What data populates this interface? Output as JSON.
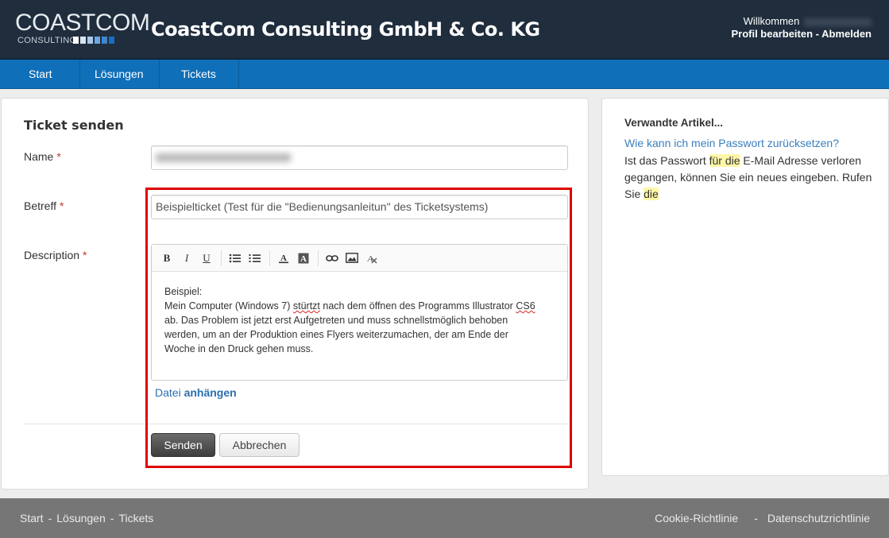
{
  "header": {
    "logo_text": "COASTCOM",
    "logo_subtext": "CONSULTING",
    "logo_square_colors": [
      "#ffffff",
      "#d6e4f3",
      "#a9c8ea",
      "#6ea6de",
      "#3f86cf",
      "#1e6bbd"
    ],
    "company_name": "CoastCom Consulting GmbH & Co. KG",
    "welcome_text": "Willkommen",
    "profile_link": "Profil bearbeiten",
    "separator": "-",
    "logout_link": "Abmelden"
  },
  "nav": {
    "items": [
      {
        "label": "Start"
      },
      {
        "label": "Lösungen"
      },
      {
        "label": "Tickets"
      }
    ]
  },
  "form": {
    "title": "Ticket senden",
    "required_marker": "*",
    "name_label": "Name",
    "subject_label": "Betreff",
    "subject_value": "Beispielticket (Test für die \"Bedienungsanleitun\" des Ticketsystems)",
    "description_label": "Description",
    "toolbar": {
      "bold": "B",
      "italic": "I",
      "underline": "U",
      "bullet_list_icon": "bullet-list-icon",
      "numbered_list_icon": "numbered-list-icon",
      "font_color_icon": "font-color-icon",
      "bg_color_icon": "background-color-icon",
      "link_icon": "link-icon",
      "image_icon": "image-icon",
      "clear_format_icon": "clear-format-icon"
    },
    "description_lines": {
      "l1": "Beispiel:",
      "l2a": "Mein Computer (Windows 7) ",
      "l2b": "stürtzt",
      "l2c": " nach dem öffnen des Programms Illustrator ",
      "l2d": "CS6",
      "l3": "ab. Das Problem ist jetzt erst Aufgetreten und muss schnellstmöglich behoben",
      "l4": "werden, um an der Produktion eines Flyers weiterzumachen, der am Ende der",
      "l5": "Woche in den Druck gehen muss."
    },
    "attach_prefix": "Datei",
    "attach_action": "anhängen",
    "send_button": "Senden",
    "cancel_button": "Abbrechen"
  },
  "sidebar": {
    "title": "Verwandte Artikel...",
    "article_link": "Wie kann ich mein Passwort zurücksetzen?",
    "snippet_1": "Ist das Passwort ",
    "snippet_hl1": "für die",
    "snippet_2": " E-Mail Adresse verloren gegangen, können Sie ein neues eingeben. Rufen Sie ",
    "snippet_hl2": "die"
  },
  "footer": {
    "left_links": [
      "Start",
      "Lösungen",
      "Tickets"
    ],
    "right_links": [
      "Cookie-Richtlinie",
      "Datenschutzrichtlinie"
    ],
    "separator": "-"
  },
  "colors": {
    "header_bg": "#1f2d3d",
    "nav_bg": "#0f6fb8",
    "highlight_border": "#e00000",
    "footer_bg": "#767676",
    "link": "#3a7fbf"
  }
}
